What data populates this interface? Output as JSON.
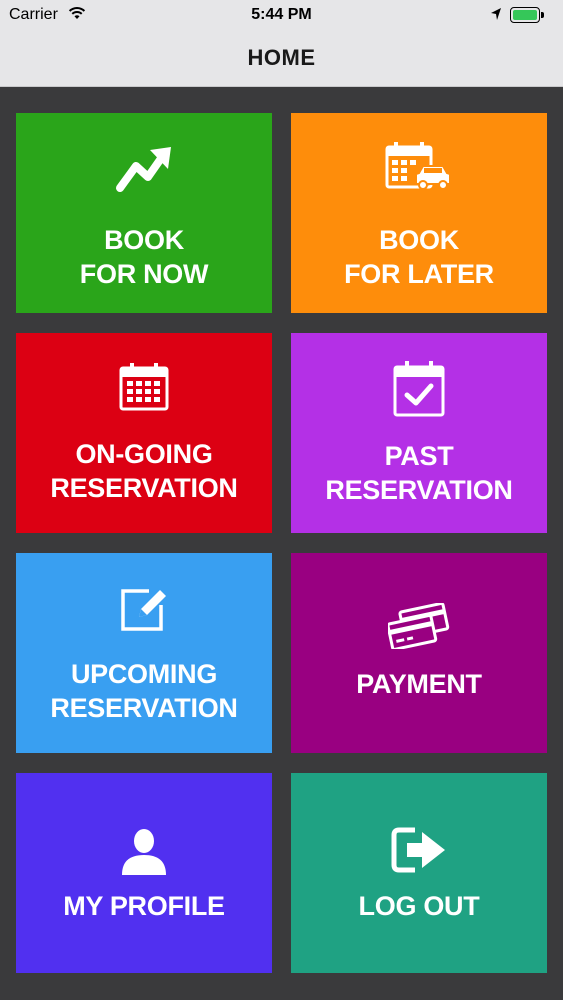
{
  "status_bar": {
    "carrier": "Carrier",
    "time": "5:44 PM"
  },
  "nav": {
    "title": "HOME"
  },
  "tiles": [
    {
      "line1": "BOOK",
      "line2": "FOR NOW",
      "color": "#2aa51a",
      "icon": "trending-up-icon"
    },
    {
      "line1": "BOOK",
      "line2": "FOR LATER",
      "color": "#fe8d0b",
      "icon": "calendar-car-icon"
    },
    {
      "line1": "ON-GOING",
      "line2": "RESERVATION",
      "color": "#dc0013",
      "icon": "calendar-icon"
    },
    {
      "line1": "PAST",
      "line2": "RESERVATION",
      "color": "#b430e6",
      "icon": "calendar-check-icon"
    },
    {
      "line1": "UPCOMING",
      "line2": "RESERVATION",
      "color": "#399ff1",
      "icon": "edit-icon"
    },
    {
      "line1": "PAYMENT",
      "line2": "",
      "color": "#990081",
      "icon": "credit-cards-icon"
    },
    {
      "line1": "MY PROFILE",
      "line2": "",
      "color": "#5130f0",
      "icon": "user-icon"
    },
    {
      "line1": "LOG OUT",
      "line2": "",
      "color": "#1fa283",
      "icon": "logout-icon"
    }
  ]
}
